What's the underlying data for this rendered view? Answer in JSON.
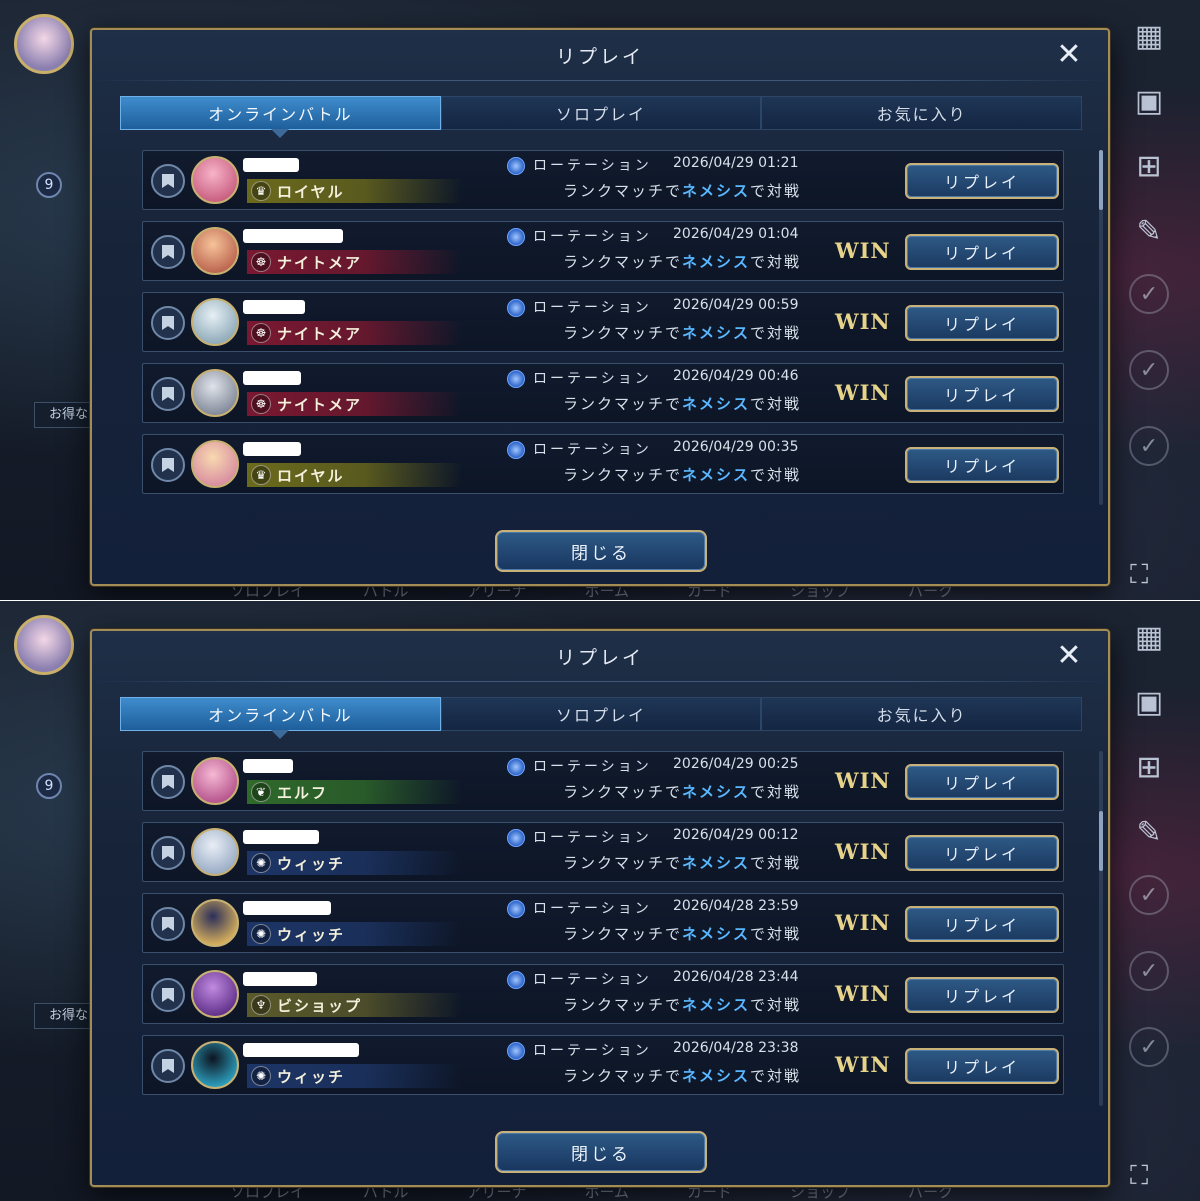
{
  "background": {
    "rank_number": "9",
    "promo_text": "お得なクリス",
    "nav_items": [
      "ソロプレイ",
      "バトル",
      "アリーナ",
      "ホーム",
      "カード",
      "ショップ",
      "パーク"
    ]
  },
  "side_icons": [
    "grid-menu-icon",
    "gallery-edit-icon",
    "gift-icon",
    "scroll-icon"
  ],
  "class_colors": {
    "royal": "#6b6a1c",
    "nightmare": "#7a1830",
    "elf": "#2f6a2a",
    "witch": "#1d3566",
    "bishop": "#5b5a2a"
  },
  "screens": [
    {
      "modal": {
        "title": "リプレイ",
        "close_glyph": "✕",
        "tabs": [
          {
            "label": "オンラインバトル",
            "active": true
          },
          {
            "label": "ソロプレイ",
            "active": false
          },
          {
            "label": "お気に入り",
            "active": false
          }
        ],
        "close_button": "閉じる",
        "rows": [
          {
            "class_name": "ロイヤル",
            "class_key": "royal",
            "class_icon": "crown-icon",
            "format": "ローテーション",
            "datetime": "2026/04/29 01:21",
            "match_prefix": "ランクマッチで",
            "match_highlight": "ネメシス",
            "match_suffix": "で対戦",
            "result": "",
            "replay": "リプレイ"
          },
          {
            "class_name": "ナイトメア",
            "class_key": "nightmare",
            "class_icon": "nightmare-icon",
            "format": "ローテーション",
            "datetime": "2026/04/29 01:04",
            "match_prefix": "ランクマッチで",
            "match_highlight": "ネメシス",
            "match_suffix": "で対戦",
            "result": "WIN",
            "replay": "リプレイ"
          },
          {
            "class_name": "ナイトメア",
            "class_key": "nightmare",
            "class_icon": "nightmare-icon",
            "format": "ローテーション",
            "datetime": "2026/04/29 00:59",
            "match_prefix": "ランクマッチで",
            "match_highlight": "ネメシス",
            "match_suffix": "で対戦",
            "result": "WIN",
            "replay": "リプレイ"
          },
          {
            "class_name": "ナイトメア",
            "class_key": "nightmare",
            "class_icon": "nightmare-icon",
            "format": "ローテーション",
            "datetime": "2026/04/29 00:46",
            "match_prefix": "ランクマッチで",
            "match_highlight": "ネメシス",
            "match_suffix": "で対戦",
            "result": "WIN",
            "replay": "リプレイ"
          },
          {
            "class_name": "ロイヤル",
            "class_key": "royal",
            "class_icon": "crown-icon",
            "format": "ローテーション",
            "datetime": "2026/04/29 00:35",
            "match_prefix": "ランクマッチで",
            "match_highlight": "ネメシス",
            "match_suffix": "で対戦",
            "result": "",
            "replay": "リプレイ"
          }
        ]
      }
    },
    {
      "modal": {
        "title": "リプレイ",
        "close_glyph": "✕",
        "tabs": [
          {
            "label": "オンラインバトル",
            "active": true
          },
          {
            "label": "ソロプレイ",
            "active": false
          },
          {
            "label": "お気に入り",
            "active": false
          }
        ],
        "close_button": "閉じる",
        "rows": [
          {
            "class_name": "エルフ",
            "class_key": "elf",
            "class_icon": "leaf-icon",
            "format": "ローテーション",
            "datetime": "2026/04/29 00:25",
            "match_prefix": "ランクマッチで",
            "match_highlight": "ネメシス",
            "match_suffix": "で対戦",
            "result": "WIN",
            "replay": "リプレイ"
          },
          {
            "class_name": "ウィッチ",
            "class_key": "witch",
            "class_icon": "witch-icon",
            "format": "ローテーション",
            "datetime": "2026/04/29 00:12",
            "match_prefix": "ランクマッチで",
            "match_highlight": "ネメシス",
            "match_suffix": "で対戦",
            "result": "WIN",
            "replay": "リプレイ"
          },
          {
            "class_name": "ウィッチ",
            "class_key": "witch",
            "class_icon": "witch-icon",
            "format": "ローテーション",
            "datetime": "2026/04/28 23:59",
            "match_prefix": "ランクマッチで",
            "match_highlight": "ネメシス",
            "match_suffix": "で対戦",
            "result": "WIN",
            "replay": "リプレイ"
          },
          {
            "class_name": "ビショップ",
            "class_key": "bishop",
            "class_icon": "bishop-icon",
            "format": "ローテーション",
            "datetime": "2026/04/28 23:44",
            "match_prefix": "ランクマッチで",
            "match_highlight": "ネメシス",
            "match_suffix": "で対戦",
            "result": "WIN",
            "replay": "リプレイ"
          },
          {
            "class_name": "ウィッチ",
            "class_key": "witch",
            "class_icon": "witch-icon",
            "format": "ローテーション",
            "datetime": "2026/04/28 23:38",
            "match_prefix": "ランクマッチで",
            "match_highlight": "ネメシス",
            "match_suffix": "で対戦",
            "result": "WIN",
            "replay": "リプレイ"
          }
        ]
      }
    }
  ]
}
